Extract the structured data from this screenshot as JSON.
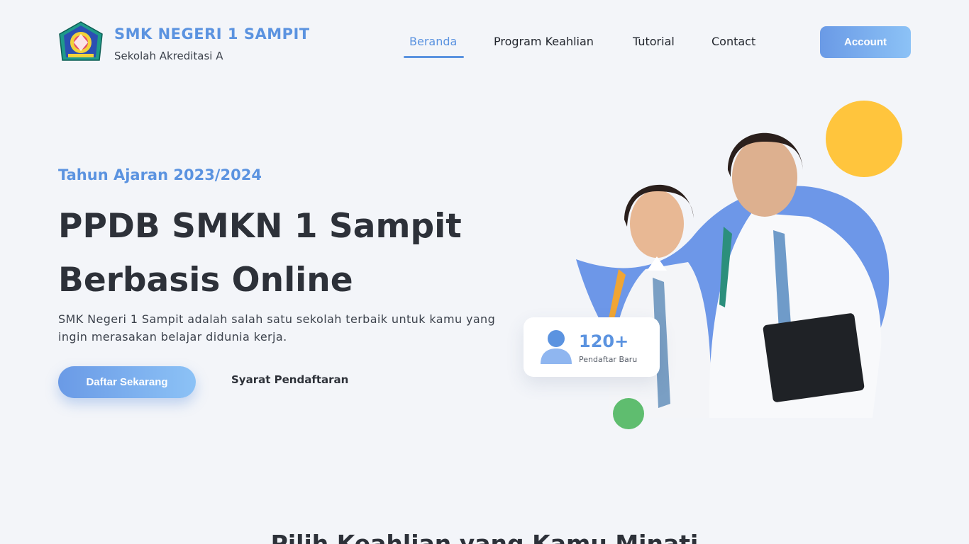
{
  "header": {
    "brand_title": "SMK NEGERI 1 SAMPIT",
    "brand_subtitle": "Sekolah Akreditasi A",
    "logo_icon": "school-crest-icon",
    "nav": [
      {
        "label": "Beranda",
        "active": true
      },
      {
        "label": "Program Keahlian",
        "active": false
      },
      {
        "label": "Tutorial",
        "active": false
      },
      {
        "label": "Contact",
        "active": false
      }
    ],
    "account_label": "Account"
  },
  "hero": {
    "academic_year": "Tahun Ajaran 2023/2024",
    "title_line1": "PPDB SMKN 1 Sampit",
    "title_line2": "Berbasis Online",
    "description": "SMK Negeri 1 Sampit adalah salah satu sekolah terbaik untuk kamu yang ingin merasakan belajar didunia kerja.",
    "primary_button": "Daftar Sekarang",
    "secondary_link": "Syarat Pendaftaran",
    "stat": {
      "value": "120+",
      "label": "Pendaftar Baru",
      "icon": "user-icon"
    }
  },
  "next_section": {
    "heading": "Pilih Keahlian yang Kamu Minati"
  },
  "colors": {
    "accent": "#5b93e0",
    "gradient_start": "#6a9ae6",
    "gradient_end": "#8cc2f6",
    "yellow": "#ffc53d",
    "green": "#5fbd6f",
    "background": "#f3f5f9",
    "text_dark": "#2d3139"
  }
}
